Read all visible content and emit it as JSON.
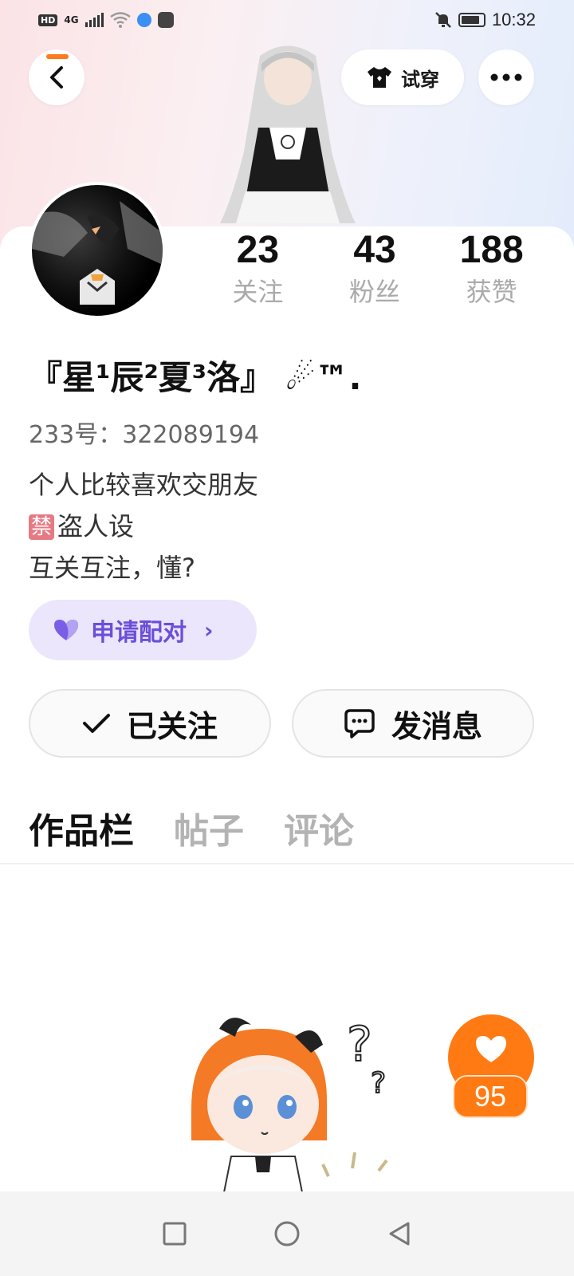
{
  "status_bar": {
    "hd": "HD",
    "network": "4G",
    "time": "10:32"
  },
  "top_actions": {
    "tryon_label": "试穿"
  },
  "profile": {
    "nickname": "『星¹辰²夏³洛』 ☄™.",
    "user_id": "233号：322089194",
    "bio_line1": "个人比较喜欢交朋友",
    "bio_ban": "禁",
    "bio_line2": "盗人设",
    "bio_line3": "互关互注，懂?"
  },
  "stats": [
    {
      "value": "23",
      "label": "关注"
    },
    {
      "value": "43",
      "label": "粉丝"
    },
    {
      "value": "188",
      "label": "获赞"
    }
  ],
  "pair_button": {
    "label": "申请配对",
    "chevron": "›"
  },
  "actions": {
    "follow_label": "已关注",
    "message_label": "发消息"
  },
  "tabs": [
    {
      "label": "作品栏",
      "active": true
    },
    {
      "label": "帖子",
      "active": false
    },
    {
      "label": "评论",
      "active": false
    }
  ],
  "like_fab": {
    "count": "95"
  },
  "colors": {
    "accent_orange": "#ff7a12",
    "pair_purple": "#6b4fd8",
    "pair_bg": "#ebe6fb"
  },
  "icons": [
    "back-arrow-icon",
    "shirt-icon",
    "more-dots-icon",
    "heart-icon",
    "check-icon",
    "chat-bubble-icon",
    "square-nav-icon",
    "circle-nav-icon",
    "triangle-back-icon"
  ]
}
